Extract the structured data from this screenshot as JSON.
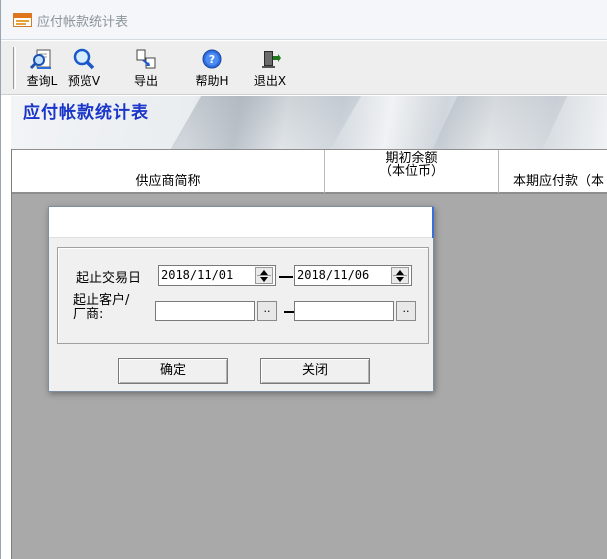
{
  "window": {
    "title": "应付帐款统计表"
  },
  "toolbar": {
    "buttons": [
      {
        "label": "查询L",
        "icon": "magnifier-document-icon"
      },
      {
        "label": "预览V",
        "icon": "magnifier-icon"
      },
      {
        "label": "导出",
        "icon": "export-icon"
      },
      {
        "label": "帮助H",
        "icon": "help-icon"
      },
      {
        "label": "退出X",
        "icon": "exit-door-icon"
      }
    ]
  },
  "banner": {
    "title": "应付帐款统计表"
  },
  "grid": {
    "columns": [
      {
        "label": "供应商简称"
      },
      {
        "label_line1": "期初余额",
        "label_line2": "（本位币）"
      },
      {
        "label": "本期应付款（本"
      }
    ]
  },
  "dialog": {
    "date_label": "起止交易日",
    "date_from": "2018/11/01",
    "date_to": "2018/11/06",
    "customer_label_line1": "起止客户/",
    "customer_label_line2": "厂商:",
    "customer_from": "",
    "customer_to": "",
    "browse_label": "..",
    "ok_label": "确定",
    "close_label": "关闭"
  },
  "colors": {
    "report_title": "#1a35c9",
    "grid_background": "#a9a9a9",
    "toolbar_background": "#eeeeee"
  }
}
